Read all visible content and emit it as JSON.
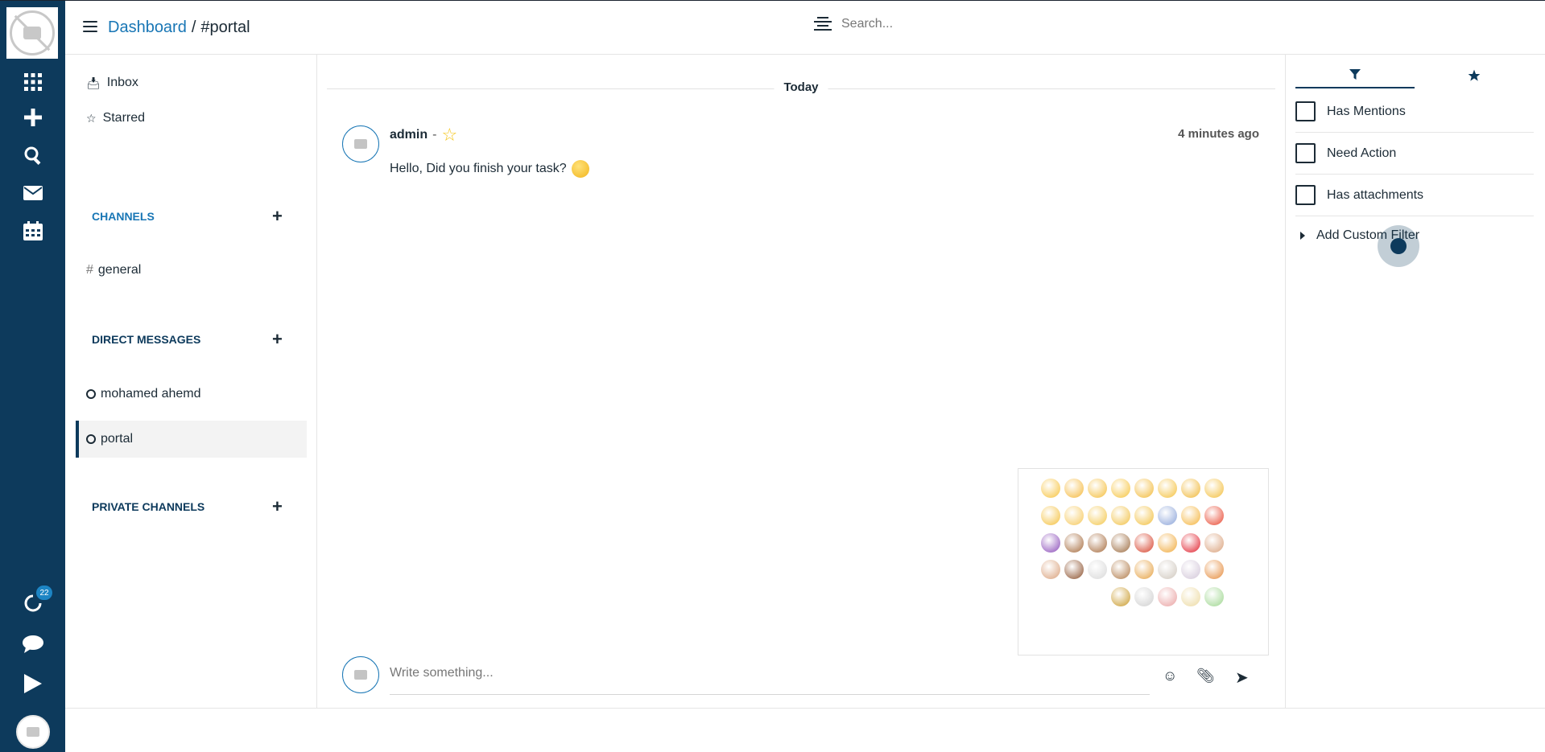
{
  "header": {
    "breadcrumb_root": "Dashboard",
    "breadcrumb_sep": "/",
    "breadcrumb_current": "#portal",
    "search_placeholder": "Search..."
  },
  "rail": {
    "badge_count": "22"
  },
  "sidebar": {
    "inbox": "Inbox",
    "starred": "Starred",
    "channels_title": "CHANNELS",
    "channels": [
      {
        "name": "general"
      }
    ],
    "direct_title": "DIRECT MESSAGES",
    "direct": [
      {
        "name": "mohamed ahemd"
      },
      {
        "name": "portal"
      }
    ],
    "private_title": "PRIVATE CHANNELS"
  },
  "chat": {
    "date_divider": "Today",
    "message": {
      "author": "admin",
      "separator": "-",
      "time": "4 minutes ago",
      "text": "Hello, Did you finish your task?"
    },
    "composer_placeholder": "Write something..."
  },
  "filters": {
    "items": [
      {
        "label": "Has Mentions"
      },
      {
        "label": "Need Action"
      },
      {
        "label": "Has attachments"
      }
    ],
    "custom": "Add Custom Filter"
  },
  "colors": {
    "primary": "#0d3a5c",
    "link": "#1876b5",
    "accent_star": "#f5c518"
  }
}
